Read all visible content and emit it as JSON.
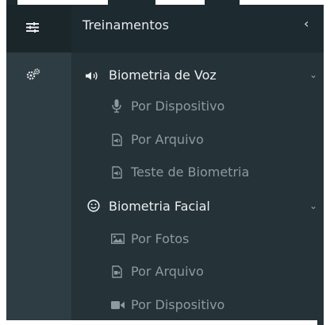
{
  "header": {
    "title": "Treinamentos"
  },
  "sidebar": {
    "items": [
      {
        "label": "Biometria de Voz",
        "icon": "speaker-icon",
        "children": [
          {
            "label": "Por Dispositivo",
            "icon": "microphone-icon"
          },
          {
            "label": "Por Arquivo",
            "icon": "audio-file-icon"
          },
          {
            "label": "Teste de Biometria",
            "icon": "audio-file-icon"
          }
        ]
      },
      {
        "label": "Biometria Facial",
        "icon": "smiley-icon",
        "children": [
          {
            "label": "Por Fotos",
            "icon": "image-icon"
          },
          {
            "label": "Por Arquivo",
            "icon": "video-file-icon"
          },
          {
            "label": "Por Dispositivo",
            "icon": "video-camera-icon"
          }
        ]
      }
    ]
  },
  "colors": {
    "background": "#253238",
    "header": "#1d2a30",
    "rail": "#2e3c43",
    "text": "#eaeff1",
    "muted": "#8d9aa0"
  }
}
